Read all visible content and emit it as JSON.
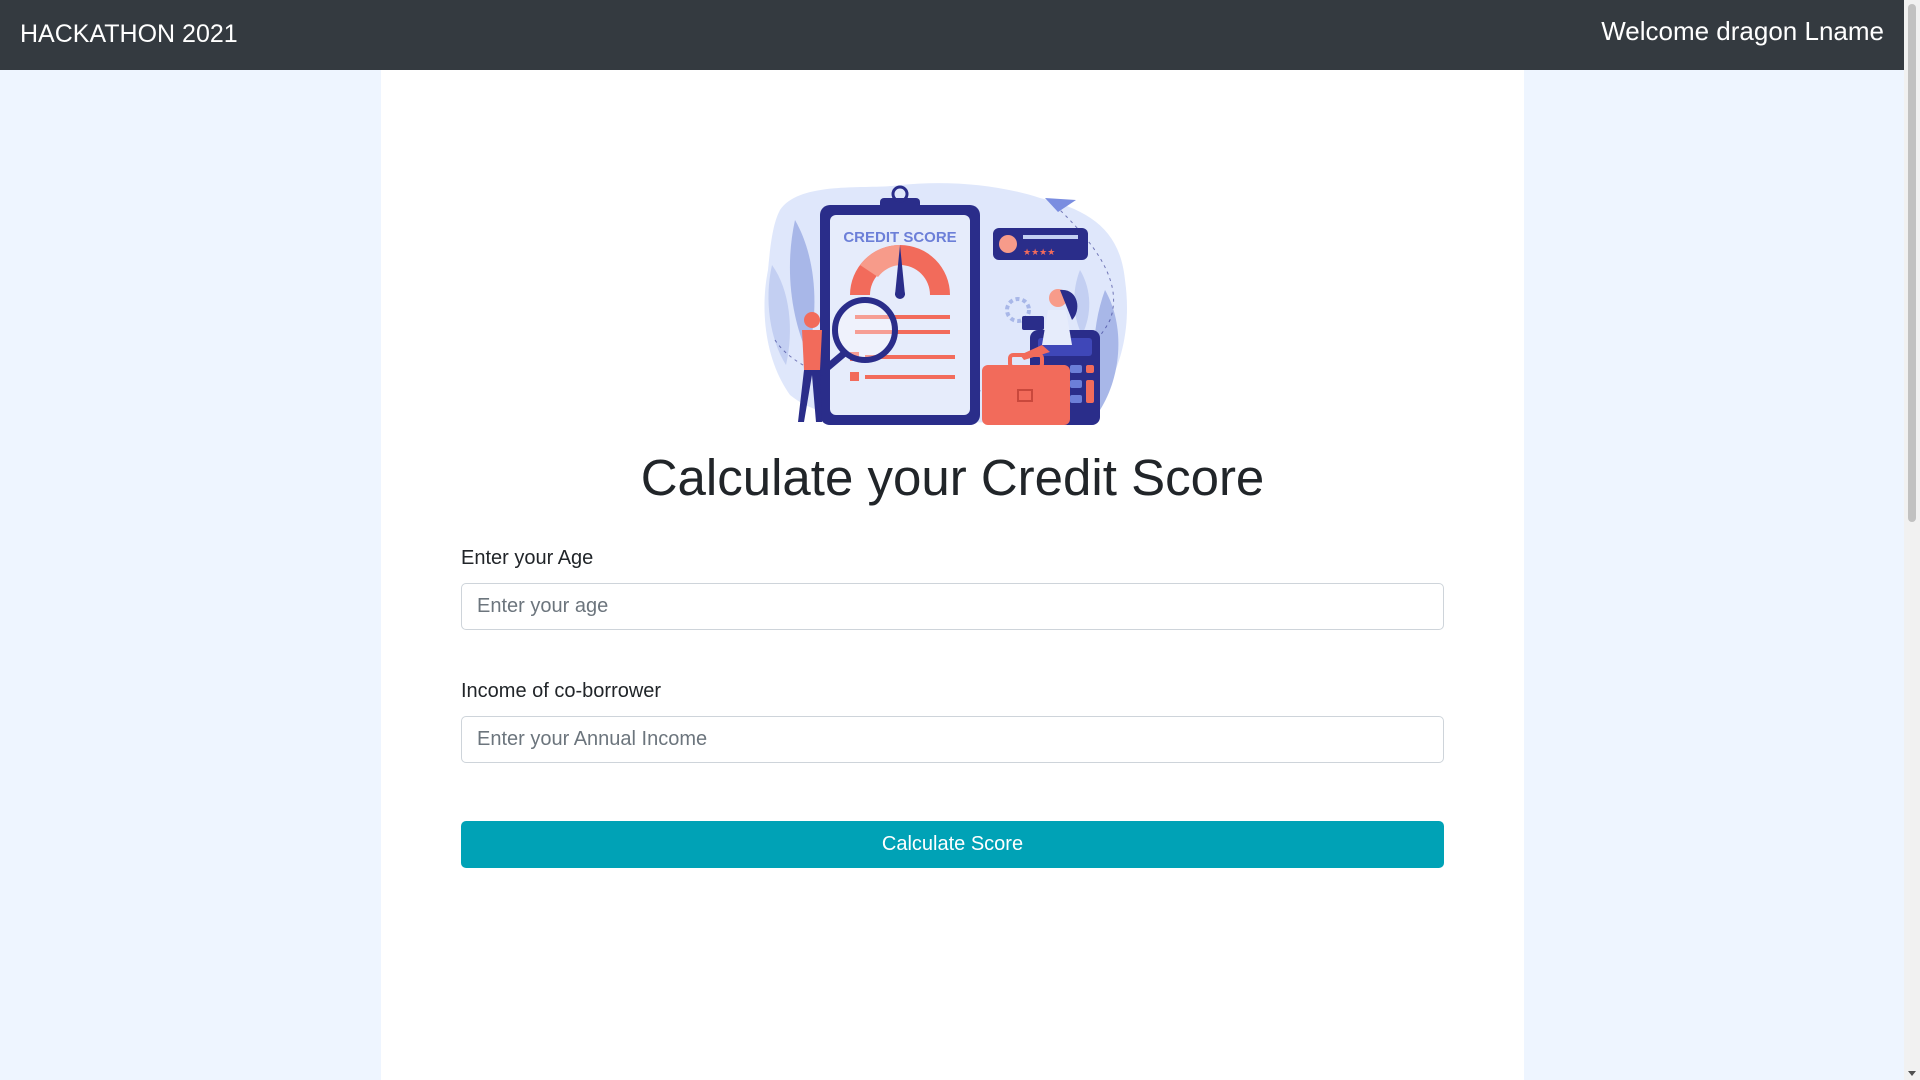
{
  "navbar": {
    "brand": "HACKATHON 2021",
    "welcome": "Welcome dragon Lname"
  },
  "illustration": {
    "icon": "credit-score-illustration",
    "clipboard_text": "CREDIT SCORE"
  },
  "form": {
    "title": "Calculate your Credit Score",
    "age_label": "Enter your Age",
    "age_placeholder": "Enter your age",
    "income_label": "Income of co-borrower",
    "income_placeholder": "Enter your Annual Income",
    "submit_label": "Calculate Score"
  },
  "colors": {
    "navbar": "#343a40",
    "page_background": "#eef5ff",
    "button": "#00a2b6"
  }
}
